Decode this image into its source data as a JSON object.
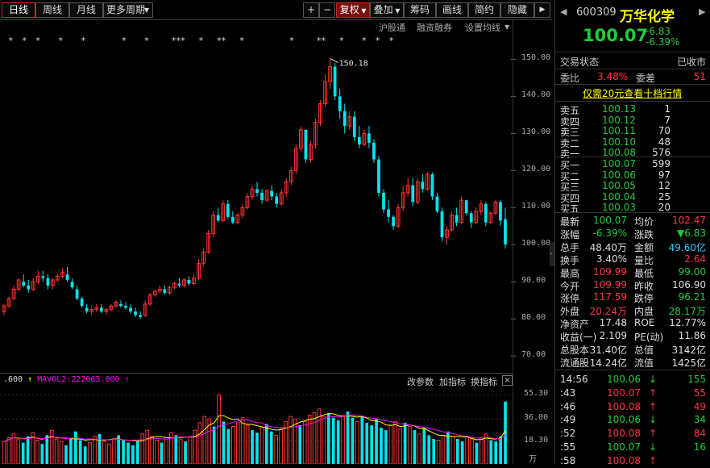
{
  "toolbar": {
    "period_buttons": [
      "日线",
      "周线",
      "月线",
      "更多周期"
    ],
    "right_buttons": [
      "复权",
      "叠加",
      "筹码",
      "画线",
      "简约",
      "隐藏"
    ],
    "plus": "+",
    "minus": "−",
    "sub_links": [
      "沪股通",
      "融资融券",
      "设置均线"
    ]
  },
  "markers": "*  *  *    *    *        *    *     ***   *   **   *          *     **   *    *  *  *",
  "chart_data": {
    "type": "candlestick",
    "y_ticks": [
      "150.00",
      "140.00",
      "130.00",
      "120.00",
      "110.00",
      "100.00",
      "90.00",
      "80.00",
      "70.00"
    ],
    "ylim": [
      67,
      154
    ],
    "peak_label": "150.18",
    "up_color": "#ff3333",
    "down_color": "#00e5ee",
    "candles": [
      [
        82,
        84,
        81,
        83.5
      ],
      [
        83.5,
        86,
        83,
        85.5
      ],
      [
        85.5,
        89,
        85,
        88
      ],
      [
        88,
        91,
        87.5,
        90.5
      ],
      [
        90,
        92,
        88.5,
        89
      ],
      [
        89,
        90.5,
        87,
        88
      ],
      [
        88,
        91,
        87.5,
        90
      ],
      [
        90,
        93,
        89.5,
        91.5
      ],
      [
        91.5,
        93,
        90,
        91
      ],
      [
        91,
        92,
        88,
        89
      ],
      [
        89,
        91,
        88,
        90.5
      ],
      [
        90.5,
        92,
        90,
        91.5
      ],
      [
        91.5,
        93.5,
        91,
        92.5
      ],
      [
        92,
        94,
        90,
        90.5
      ],
      [
        90,
        91,
        88,
        88.5
      ],
      [
        88,
        89,
        85,
        85.5
      ],
      [
        85.5,
        86,
        83,
        83.5
      ],
      [
        83,
        84,
        81.5,
        82
      ],
      [
        82,
        83.5,
        81,
        82.5
      ],
      [
        82.5,
        84,
        82,
        83
      ],
      [
        83,
        84,
        81.5,
        82
      ],
      [
        82,
        83,
        81,
        82.5
      ],
      [
        82.5,
        84,
        82,
        83.5
      ],
      [
        83.5,
        85,
        83,
        84.5
      ],
      [
        84,
        85,
        83,
        83.5
      ],
      [
        83.5,
        84.5,
        82.5,
        83
      ],
      [
        83,
        84,
        81.5,
        82
      ],
      [
        82,
        83,
        80.5,
        81
      ],
      [
        81,
        82,
        80,
        80.5
      ],
      [
        81,
        85,
        80.5,
        84
      ],
      [
        84,
        87,
        83.5,
        86.5
      ],
      [
        86.5,
        88,
        86,
        87.5
      ],
      [
        87.5,
        89,
        87,
        88
      ],
      [
        88,
        89,
        86.5,
        87
      ],
      [
        87,
        89,
        86.5,
        88.5
      ],
      [
        88.5,
        90,
        88,
        89.5
      ],
      [
        89.5,
        91,
        88.5,
        89
      ],
      [
        89,
        91,
        88.5,
        90.5
      ],
      [
        90.5,
        91.5,
        89,
        89.5
      ],
      [
        89.5,
        92,
        89,
        91
      ],
      [
        91,
        96,
        90.5,
        95
      ],
      [
        95,
        99,
        94,
        98
      ],
      [
        98,
        104,
        97.5,
        103
      ],
      [
        103,
        109,
        102,
        108
      ],
      [
        108,
        110,
        106,
        106.5
      ],
      [
        106.5,
        112,
        106,
        111
      ],
      [
        111,
        112,
        107,
        107.5
      ],
      [
        107.5,
        109,
        105.5,
        106
      ],
      [
        106,
        108.5,
        105.5,
        108
      ],
      [
        108,
        111,
        107,
        110
      ],
      [
        110,
        114,
        109.5,
        113
      ],
      [
        113,
        116,
        112,
        115
      ],
      [
        115,
        117,
        113,
        114
      ],
      [
        114,
        115,
        111,
        112
      ],
      [
        112,
        115,
        111.5,
        114.5
      ],
      [
        114.5,
        116,
        112,
        113
      ],
      [
        113,
        114,
        110,
        111
      ],
      [
        111,
        115,
        110.5,
        114
      ],
      [
        114,
        118,
        113,
        117
      ],
      [
        117,
        121,
        116,
        120
      ],
      [
        120,
        127,
        119,
        126
      ],
      [
        126,
        132,
        125,
        131
      ],
      [
        131,
        130,
        122,
        123
      ],
      [
        123,
        128,
        122,
        127
      ],
      [
        127,
        134,
        126,
        133
      ],
      [
        133,
        139,
        132,
        138
      ],
      [
        138,
        146,
        137,
        144
      ],
      [
        144,
        150.18,
        142,
        148
      ],
      [
        148,
        149,
        139,
        140
      ],
      [
        140,
        142,
        134,
        136
      ],
      [
        136,
        138,
        130,
        132
      ],
      [
        132,
        136,
        131,
        134.5
      ],
      [
        134.5,
        136,
        128,
        129
      ],
      [
        129,
        132,
        126,
        127
      ],
      [
        127,
        131,
        126.5,
        130
      ],
      [
        130,
        132,
        126,
        127.5
      ],
      [
        127.5,
        128.5,
        122,
        123
      ],
      [
        123,
        124,
        113,
        114
      ],
      [
        114,
        115,
        108.5,
        109.5
      ],
      [
        109.5,
        112,
        106,
        107.5
      ],
      [
        107.5,
        108,
        104,
        105
      ],
      [
        105,
        111,
        104.5,
        110
      ],
      [
        110,
        116,
        109,
        114
      ],
      [
        114,
        118,
        113,
        116
      ],
      [
        116,
        118,
        110.5,
        111.5
      ],
      [
        111.5,
        118,
        111,
        117
      ],
      [
        117,
        119,
        114,
        115
      ],
      [
        115,
        119.5,
        114.5,
        119
      ],
      [
        119,
        119.5,
        112,
        113
      ],
      [
        113,
        114,
        108.5,
        109
      ],
      [
        109,
        110,
        101,
        102
      ],
      [
        102,
        105,
        100,
        104
      ],
      [
        104,
        109,
        103.5,
        108
      ],
      [
        108,
        110,
        105,
        106
      ],
      [
        106,
        113,
        105.5,
        112
      ],
      [
        112,
        112,
        108,
        108.5
      ],
      [
        108.5,
        109,
        104.5,
        106
      ],
      [
        106,
        110,
        105.5,
        109
      ],
      [
        109,
        112,
        108,
        111
      ],
      [
        111,
        111.5,
        105,
        106
      ],
      [
        106,
        109,
        105.5,
        108.5
      ],
      [
        108.5,
        112,
        108,
        111.5
      ],
      [
        111.5,
        112,
        105,
        106.5
      ],
      [
        106.9,
        109.99,
        99,
        100.07
      ]
    ]
  },
  "volume": {
    "label_prefix": ".600",
    "mavol_label": "MAVOL2:222063.000",
    "arrow": "↑",
    "controls": [
      "改参数",
      "加指标",
      "换指标"
    ],
    "close": "×",
    "y_ticks": [
      "55.30",
      "36.00",
      "18.30",
      "万"
    ],
    "bars": [
      18,
      21,
      24,
      20,
      17,
      22,
      25,
      19,
      16,
      23,
      27,
      20,
      18,
      15,
      21,
      26,
      19,
      14,
      17,
      22,
      24,
      18,
      16,
      20,
      23,
      19,
      17,
      15,
      18,
      24,
      27,
      22,
      19,
      17,
      21,
      25,
      23,
      20,
      18,
      22,
      27,
      33,
      38,
      36,
      30,
      55.3,
      34,
      28,
      30,
      33,
      37,
      31,
      27,
      25,
      29,
      32,
      26,
      23,
      28,
      34,
      38,
      36,
      31,
      34,
      39,
      41,
      44,
      38,
      40,
      37,
      35,
      39,
      42,
      37,
      34,
      38,
      33,
      31,
      36,
      29,
      27,
      31,
      34,
      28,
      33,
      30,
      27,
      24,
      29,
      23,
      20,
      19,
      23,
      26,
      22,
      20,
      18,
      22,
      20,
      17,
      21,
      24,
      19,
      18,
      22,
      50
    ]
  },
  "quote": {
    "code": "600309",
    "name": "万华化学",
    "price": "100.07",
    "change": "-6.83",
    "change_pct": "-6.39%",
    "state_label": "交易状态",
    "state_value": "已收市",
    "ratio_label": "委比",
    "ratio_value": "3.48%",
    "diff_label": "委差",
    "diff_value": "51",
    "promo_link": "仅需20元查看十档行情",
    "asks": [
      [
        "卖五",
        "100.13",
        "1"
      ],
      [
        "卖四",
        "100.12",
        "7"
      ],
      [
        "卖三",
        "100.11",
        "70"
      ],
      [
        "卖二",
        "100.10",
        "48"
      ],
      [
        "卖一",
        "100.08",
        "576"
      ]
    ],
    "bids": [
      [
        "买一",
        "100.07",
        "599"
      ],
      [
        "买二",
        "100.06",
        "97"
      ],
      [
        "买三",
        "100.05",
        "12"
      ],
      [
        "买四",
        "100.04",
        "25"
      ],
      [
        "买五",
        "100.03",
        "20"
      ]
    ],
    "stats": [
      [
        [
          "最新",
          "100.07",
          "grn"
        ],
        [
          "均价",
          "102.47",
          "red"
        ]
      ],
      [
        [
          "涨幅",
          "-6.39%",
          "grn"
        ],
        [
          "涨跌",
          "▼6.83",
          "grn"
        ]
      ],
      [
        [
          "总手",
          "48.40万",
          "wh"
        ],
        [
          "金额",
          "49.60亿",
          "cy"
        ]
      ],
      [
        [
          "换手",
          "3.40%",
          "wh"
        ],
        [
          "量比",
          "2.64",
          "red"
        ]
      ],
      [
        [
          "最高",
          "109.99",
          "red"
        ],
        [
          "最低",
          "99.00",
          "grn"
        ]
      ],
      [
        [
          "今开",
          "109.99",
          "red"
        ],
        [
          "昨收",
          "106.90",
          "wh"
        ]
      ],
      [
        [
          "涨停",
          "117.59",
          "red"
        ],
        [
          "跌停",
          "96.21",
          "grn"
        ]
      ],
      [
        [
          "外盘",
          "20.24万",
          "red"
        ],
        [
          "内盘",
          "28.17万",
          "grn"
        ]
      ],
      [
        [
          "净资产",
          "17.48",
          "wh"
        ],
        [
          "ROE",
          "12.77%",
          "wh"
        ]
      ],
      [
        [
          "收益(一)",
          "2.109",
          "wh"
        ],
        [
          "PE(动)",
          "11.86",
          "wh"
        ]
      ],
      [
        [
          "总股本",
          "31.40亿",
          "wh"
        ],
        [
          "总值",
          "3142亿",
          "wh"
        ]
      ],
      [
        [
          "流通股",
          "14.24亿",
          "wh"
        ],
        [
          "流值",
          "1425亿",
          "wh"
        ]
      ]
    ],
    "ticks": [
      [
        "14:56",
        "100.06",
        "↓",
        "155",
        "grn"
      ],
      [
        ":43",
        "100.07",
        "↑",
        "55",
        "red"
      ],
      [
        ":46",
        "100.08",
        "↑",
        "49",
        "red"
      ],
      [
        ":49",
        "100.06",
        "↓",
        "34",
        "grn"
      ],
      [
        ":52",
        "100.08",
        "↑",
        "84",
        "red"
      ],
      [
        ":55",
        "100.07",
        "↓",
        "16",
        "grn"
      ],
      [
        ":58",
        "100.08",
        "↑",
        "",
        "red"
      ]
    ]
  }
}
